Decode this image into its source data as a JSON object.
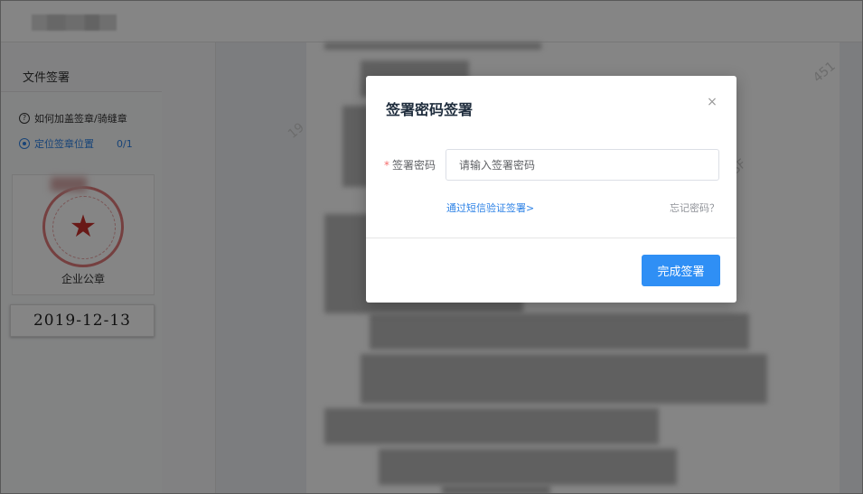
{
  "sidebar": {
    "title": "文件签署",
    "help_label": "如何加盖签章/骑缝章",
    "locate_label": "定位签章位置",
    "locate_count": "0/1",
    "seal_name": "企业公章",
    "date_stamp": "2019-12-13"
  },
  "modal": {
    "title": "签署密码签署",
    "close_glyph": "×",
    "required_mark": "*",
    "password_label": "签署密码",
    "password_placeholder": "请输入签署密码",
    "password_value": "",
    "sms_link": "通过短信验证签署>",
    "forgot_link": "忘记密码？",
    "confirm_button": "完成签署"
  },
  "icons": {
    "help": "question-circle-icon",
    "locate": "target-icon",
    "seal": "red-star-seal-icon",
    "close": "close-icon"
  },
  "colors": {
    "link_blue": "#2f83e6",
    "primary_button": "#2f8ff5",
    "required_red": "#f56c6c",
    "seal_red": "#c9302c"
  }
}
